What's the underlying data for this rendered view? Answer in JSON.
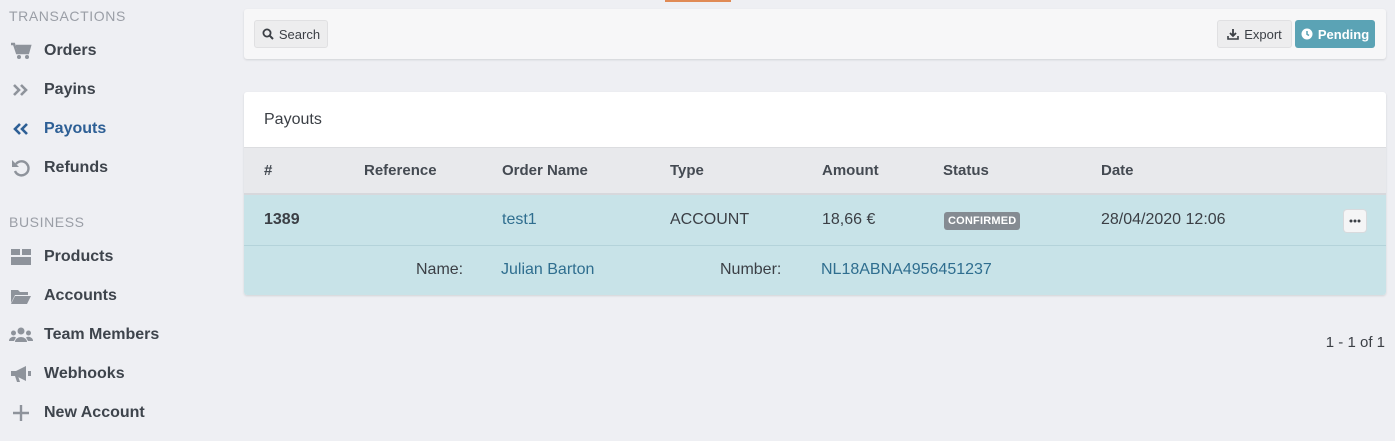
{
  "sidebar": {
    "sections": [
      {
        "title": "TRANSACTIONS",
        "items": [
          {
            "label": "Orders",
            "icon": "cart-icon"
          },
          {
            "label": "Payins",
            "icon": "double-chevron-right-icon"
          },
          {
            "label": "Payouts",
            "icon": "double-chevron-left-icon",
            "active": true
          },
          {
            "label": "Refunds",
            "icon": "undo-icon"
          }
        ]
      },
      {
        "title": "BUSINESS",
        "items": [
          {
            "label": "Products",
            "icon": "box-icon"
          },
          {
            "label": "Accounts",
            "icon": "folder-open-icon"
          },
          {
            "label": "Team Members",
            "icon": "users-icon"
          },
          {
            "label": "Webhooks",
            "icon": "megaphone-icon"
          },
          {
            "label": "New Account",
            "icon": "plus-icon"
          }
        ]
      }
    ]
  },
  "toolbar": {
    "search_label": "Search",
    "export_label": "Export",
    "pending_label": "Pending"
  },
  "table": {
    "title": "Payouts",
    "columns": [
      "#",
      "Reference",
      "Order Name",
      "Type",
      "Amount",
      "Status",
      "Date"
    ],
    "rows": [
      {
        "id": "1389",
        "reference": "",
        "order_name": "test1",
        "type": "ACCOUNT",
        "amount": "18,66 €",
        "status": "CONFIRMED",
        "date": "28/04/2020 12:06",
        "detail": {
          "name_label": "Name:",
          "name_value": "Julian Barton",
          "number_label": "Number:",
          "number_value": "NL18ABNA4956451237"
        }
      }
    ]
  },
  "pagination": "1 - 1 of 1",
  "colors": {
    "accent": "#5ba3b5",
    "active_nav": "#2d5f95",
    "selected_row": "#c8e3e8",
    "badge": "#858b92"
  }
}
